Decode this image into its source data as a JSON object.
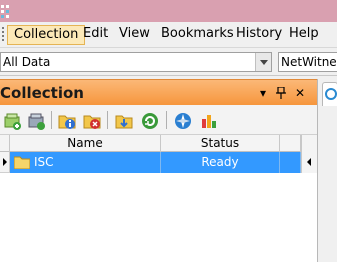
{
  "menubar": {
    "items": [
      {
        "label": "Collection"
      },
      {
        "label": "Edit"
      },
      {
        "label": "View"
      },
      {
        "label": "Bookmarks"
      },
      {
        "label": "History"
      },
      {
        "label": "Help"
      }
    ]
  },
  "filter_bar": {
    "scope_value": "All Data",
    "context_value": "NetWitness"
  },
  "panel": {
    "title": "Collection",
    "dropdown_glyph": "▾",
    "pin_glyph": "ᵠ",
    "close_glyph": "✕",
    "toolbar_icons": [
      "new-collection-icon",
      "open-collection-icon",
      "collection-info-icon",
      "delete-collection-icon",
      "import-icon",
      "refresh-icon",
      "navigate-icon",
      "report-chart-icon"
    ]
  },
  "grid": {
    "columns": [
      "Name",
      "Status"
    ],
    "rows": [
      {
        "name": "ISC",
        "status": "Ready",
        "icon": "folder-icon",
        "selected": true
      }
    ]
  },
  "colors": {
    "panel_header": "#f6963d",
    "selection": "#3399ff",
    "menu_active": "#fce9b8"
  }
}
